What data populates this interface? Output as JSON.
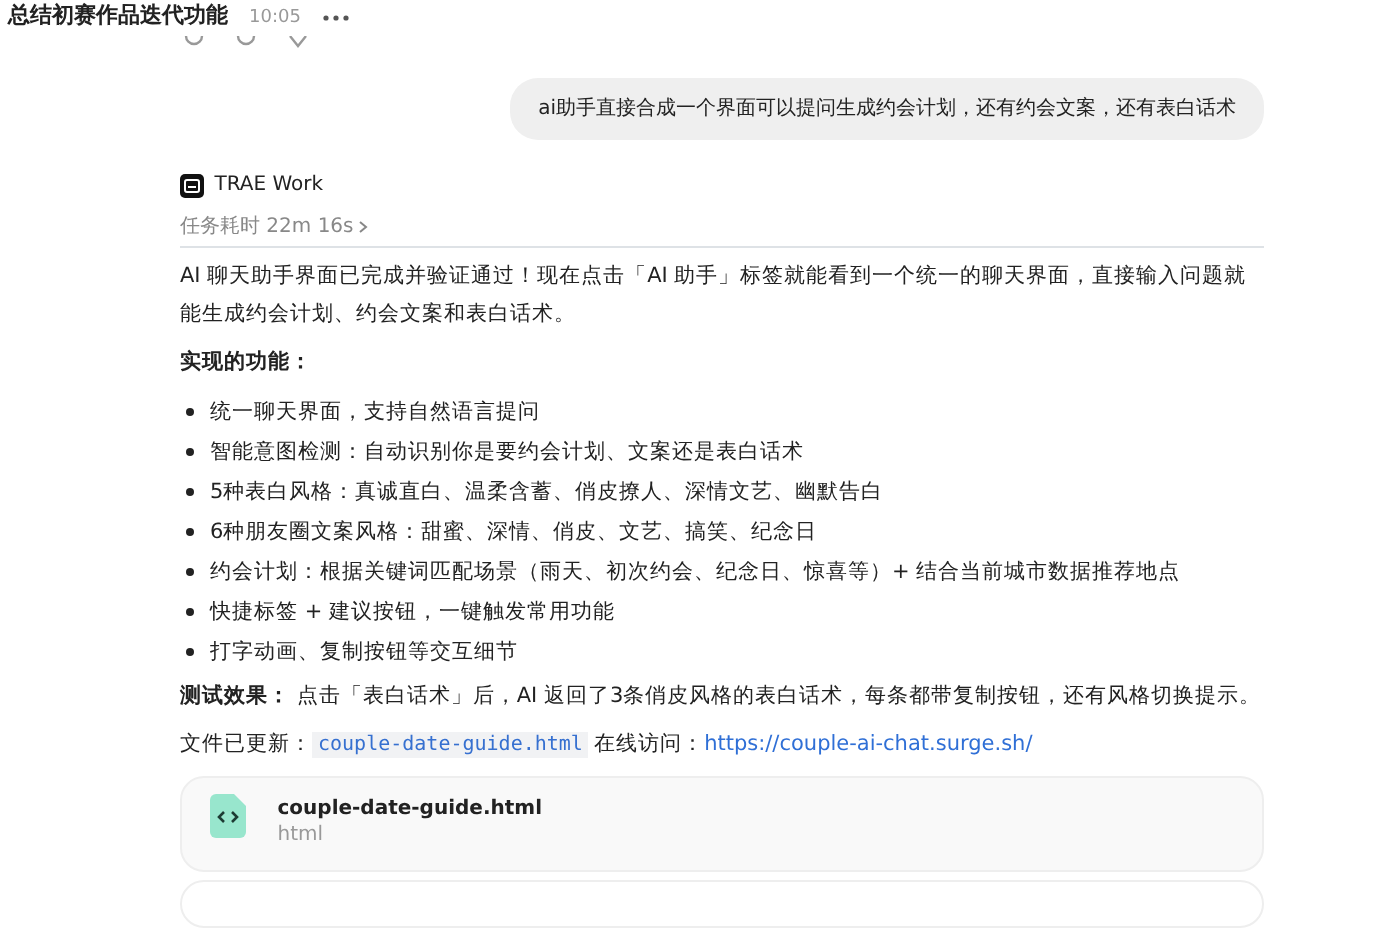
{
  "header": {
    "title": "总结初赛作品迭代功能",
    "time": "10:05"
  },
  "user_message": "ai助手直接合成一个界面可以提问生成约会计划，还有约会文案，还有表白话术",
  "agent": {
    "name": "TRAE Work",
    "duration": "任务耗时 22m 16s"
  },
  "reply": {
    "intro": "AI 聊天助手界面已完成并验证通过！现在点击「AI 助手」标签就能看到一个统一的聊天界面，直接输入问题就能生成约会计划、约会文案和表白话术。",
    "features_heading": "实现的功能：",
    "features": [
      "统一聊天界面，支持自然语言提问",
      "智能意图检测：自动识别你是要约会计划、文案还是表白话术",
      "5种表白风格：真诚直白、温柔含蓄、俏皮撩人、深情文艺、幽默告白",
      "6种朋友圈文案风格：甜蜜、深情、俏皮、文艺、搞笑、纪念日",
      "约会计划：根据关键词匹配场景（雨天、初次约会、纪念日、惊喜等）+ 结合当前城市数据推荐地点",
      "快捷标签 + 建议按钮，一键触发常用功能",
      "打字动画、复制按钮等交互细节"
    ],
    "test": "**测试效果：** 点击「表白话术」后，AI 返回了3条俏皮风格的表白话术，每条都带复制按钮，还有风格切换提示。",
    "file_update": {
      "label": "文件已更新：",
      "filename": "couple-date-guide.html",
      "online_label": "在线访问：",
      "url": "https://couple-ai-chat.surge.sh/"
    }
  },
  "attachment": {
    "name": "couple-date-guide.html",
    "type": "html"
  }
}
